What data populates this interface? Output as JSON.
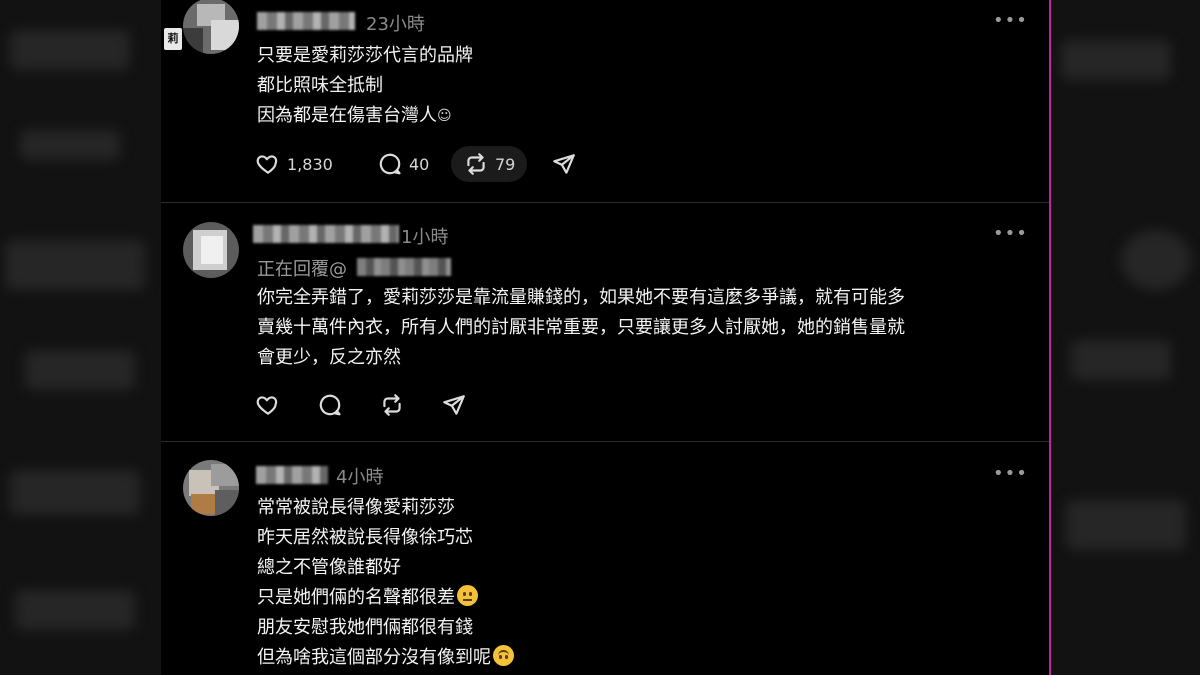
{
  "comments": [
    {
      "timestamp": "23小時",
      "side_tag": "莉",
      "lines": [
        "只要是愛莉莎莎代言的品牌",
        "都比照味全抵制",
        "因為都是在傷害台灣人"
      ],
      "trailing_glyph": "☺",
      "likes": "1,830",
      "replies": "40",
      "reposts": "79"
    },
    {
      "timestamp": "1小時",
      "reply_label": "正在回覆@",
      "lines": [
        "你完全弄錯了，愛莉莎莎是靠流量賺錢的，如果她不要有這麼多爭議，就有可能多",
        "賣幾十萬件內衣，所有人們的討厭非常重要，只要讓更多人討厭她，她的銷售量就",
        "會更少，反之亦然"
      ]
    },
    {
      "timestamp": "4小時",
      "lines": [
        "常常被說長得像愛莉莎莎",
        "昨天居然被說長得像徐巧芯",
        "總之不管像誰都好",
        "只是她們倆的名聲都很差",
        "朋友安慰我她們倆都很有錢",
        "但為啥我這個部分沒有像到呢"
      ],
      "emoji": [
        "neutral-face",
        "upside-down-face"
      ]
    }
  ],
  "icons": {
    "like": "heart-icon",
    "reply": "comment-bubble-icon",
    "repost": "repost-icon",
    "share": "send-icon",
    "more": "more-dots-icon"
  },
  "colors": {
    "background": "#000000",
    "text": "#f3f3f3",
    "muted": "#8a8a8a",
    "accent_line": "#c0249e"
  }
}
